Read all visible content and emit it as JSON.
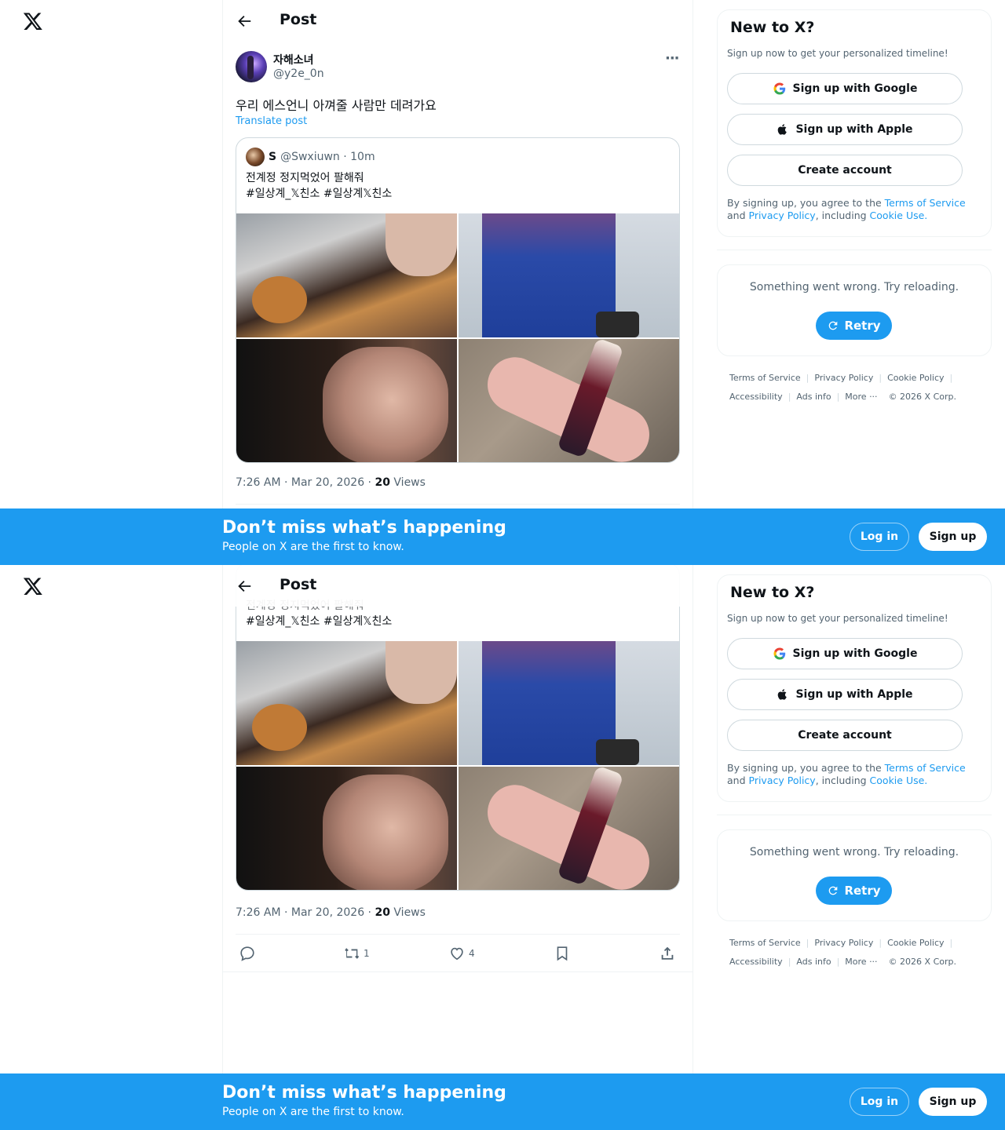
{
  "nav": {
    "logo_icon": "x-logo-icon"
  },
  "header": {
    "title": "Post",
    "back_icon": "back-arrow-icon"
  },
  "post": {
    "display_name": "자해소녀",
    "handle": "@y2e_0n",
    "text": "우리 에스언니 아껴줄 사람만 데려가요",
    "translate_label": "Translate post",
    "time": "7:26 AM · Mar 20, 2026 · ",
    "views_count": "20",
    "views_label": " Views",
    "more_icon": "more-icon"
  },
  "quote": {
    "name": "S",
    "handle": "@Swxiuwn · 10m",
    "line1": "전계정 정지먹었어 팔해줘",
    "line2": "#일상계_𝕏친소 #일상계𝕏친소"
  },
  "actions": {
    "reply_count": "",
    "repost_count": "1",
    "like_count": "4",
    "icons": [
      "reply-icon",
      "repost-icon",
      "like-icon",
      "bookmark-icon",
      "share-icon"
    ]
  },
  "signup_card": {
    "title": "New to X?",
    "subtitle": "Sign up now to get your personalized timeline!",
    "google_label": "Sign up with Google",
    "apple_label": "Sign up with Apple",
    "create_label": "Create account",
    "legal_prefix": "By signing up, you agree to the ",
    "terms": "Terms of Service",
    "and": " and ",
    "privacy": "Privacy Policy",
    "including": ", including ",
    "cookie": "Cookie Use."
  },
  "error_card": {
    "message": "Something went wrong. Try reloading.",
    "retry_label": "Retry"
  },
  "footer": {
    "terms": "Terms of Service",
    "privacy": "Privacy Policy",
    "cookie": "Cookie Policy",
    "accessibility": "Accessibility",
    "ads": "Ads info",
    "more": "More ···",
    "copyright": "© 2026 X Corp."
  },
  "banner": {
    "title": "Don’t miss what’s happening",
    "subtitle": "People on X are the first to know.",
    "login_label": "Log in",
    "signup_label": "Sign up"
  },
  "colors": {
    "accent": "#1d9bf0",
    "text": "#0f1419",
    "muted": "#536471",
    "border": "#eff3f4"
  }
}
